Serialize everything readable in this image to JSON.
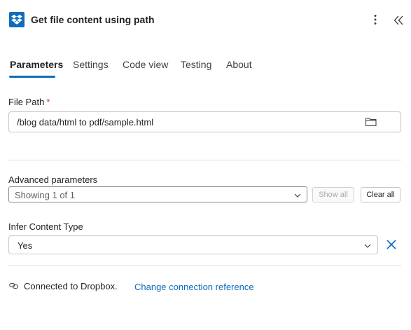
{
  "header": {
    "title": "Get file content using path",
    "app_icon": "dropbox-icon",
    "more_icon": "more-vertical-icon",
    "collapse_icon": "double-chevron-left-icon"
  },
  "tabs": [
    {
      "label": "Parameters",
      "active": true
    },
    {
      "label": "Settings",
      "active": false
    },
    {
      "label": "Code view",
      "active": false
    },
    {
      "label": "Testing",
      "active": false
    },
    {
      "label": "About",
      "active": false
    }
  ],
  "file_path": {
    "label": "File Path",
    "required_mark": "*",
    "value": "/blog data/html to pdf/sample.html",
    "icon": "folder-icon"
  },
  "advanced": {
    "label": "Advanced parameters",
    "selected": "Showing 1 of 1",
    "show_all_label": "Show all",
    "clear_all_label": "Clear all"
  },
  "infer_content_type": {
    "label": "Infer Content Type",
    "selected": "Yes",
    "remove_icon": "close-icon"
  },
  "connection": {
    "status_text": "Connected to Dropbox.",
    "change_link": "Change connection reference",
    "icon": "link-icon"
  },
  "colors": {
    "accent": "#0f6cbd",
    "required": "#c4314b",
    "border": "#c7c7c7",
    "divider": "#e0e0e0"
  }
}
